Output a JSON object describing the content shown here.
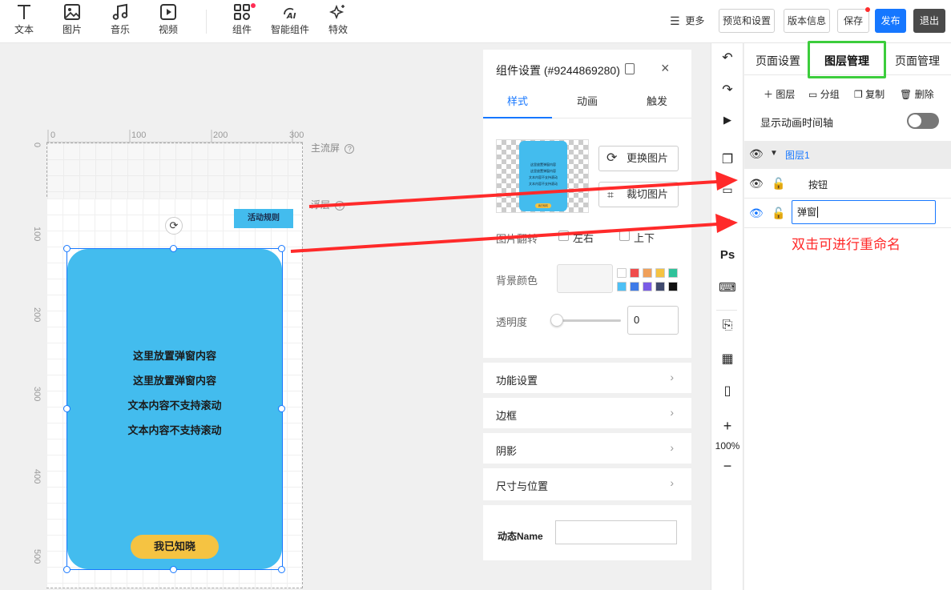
{
  "toolbar": {
    "tools": [
      {
        "label": "文本",
        "icon": "text-icon"
      },
      {
        "label": "图片",
        "icon": "image-icon"
      },
      {
        "label": "音乐",
        "icon": "music-icon"
      },
      {
        "label": "视频",
        "icon": "video-icon"
      },
      {
        "label": "组件",
        "icon": "components-icon"
      },
      {
        "label": "智能组件",
        "icon": "ai-icon"
      },
      {
        "label": "特效",
        "icon": "sparkle-icon"
      }
    ],
    "more": "更多",
    "preview_settings": "预览和设置",
    "version_info": "版本信息",
    "save": "保存",
    "publish": "发布",
    "exit": "退出"
  },
  "canvas": {
    "ruler_top": [
      "0",
      "100",
      "200",
      "300"
    ],
    "ruler_left": [
      "0",
      "100",
      "200",
      "300",
      "400",
      "500"
    ],
    "main_screen_label": "主流屏",
    "float_layer_label": "浮层",
    "rules_button": "活动规则",
    "popup_lines": [
      "这里放置弹窗内容",
      "这里放置弹窗内容",
      "文本内容不支持滚动",
      "文本内容不支持滚动"
    ],
    "popup_button": "我已知晓",
    "thumb_text": [
      "这里放置弹窗内容",
      "这里放置弹窗内容",
      "文本内容不支持滚动",
      "文本内容不支持滚动"
    ],
    "thumb_button": "我已知晓"
  },
  "settings": {
    "title": "组件设置 (#9244869280)",
    "tabs": [
      "样式",
      "动画",
      "触发"
    ],
    "replace_image": "更换图片",
    "crop_image": "裁切图片",
    "flip_label": "图片翻转",
    "flip_options": [
      "左右",
      "上下"
    ],
    "bg_color_label": "背景颜色",
    "opacity_label": "透明度",
    "opacity_value": "0",
    "opacity_level": 0,
    "sections": [
      "功能设置",
      "边框",
      "阴影",
      "尺寸与位置"
    ],
    "dynamic_name_label": "动态Name",
    "swatches": [
      "#ffffff",
      "#f04b4b",
      "#f0a05a",
      "#f5c342",
      "#2fc29a",
      "#4ec0f5",
      "#3f7be8",
      "#7a5ce6",
      "#404a6e",
      "#111111"
    ]
  },
  "iconbar": {
    "zoom": "100%",
    "ps_label": "Ps"
  },
  "layers": {
    "tabs": [
      "页面设置",
      "图层管理",
      "页面管理"
    ],
    "actions": [
      "图层",
      "分组",
      "复制",
      "删除"
    ],
    "timeline_label": "显示动画时间轴",
    "group_name": "图层1",
    "items": [
      "按钮"
    ],
    "rename_value": "弹窗",
    "annotation": "双击可进行重命名"
  },
  "colors": {
    "accent": "#1677ff",
    "popup": "#43bcee",
    "popup_button": "#f5c342",
    "annotation_red": "#ff2a2a",
    "highlight_green": "#3ccd3c"
  }
}
